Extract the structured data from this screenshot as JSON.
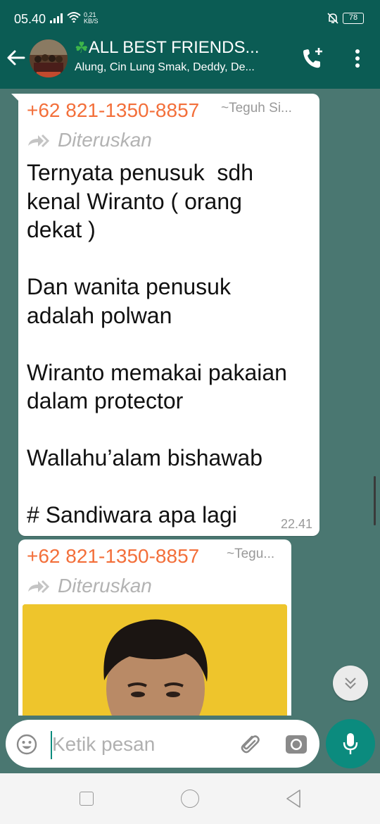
{
  "status": {
    "time": "05.40",
    "net_speed_value": "0,21",
    "net_speed_unit": "KB/S",
    "battery": "78"
  },
  "header": {
    "group_title": "ALL BEST FRIENDS...",
    "members": "Alung, Cin Lung Smak, Deddy, De...",
    "icons": [
      "back-arrow-icon",
      "add-call-icon",
      "more-vert-icon"
    ]
  },
  "messages": [
    {
      "sender": "+62 821-1350-8857",
      "push_name": "~Teguh Si...",
      "forwarded": "Diteruskan",
      "text": "Ternyata penusuk  sdh\nkenal Wiranto ( orang\ndekat )\n\nDan wanita penusuk\nadalah polwan\n\nWiranto memakai pakaian\ndalam protector\n\nWallahu’alam bishawab\n\n# Sandiwara apa lagi",
      "time": "22.41"
    },
    {
      "sender": "+62 821-1350-8857",
      "push_name": "~Tegu...",
      "forwarded": "Diteruskan"
    }
  ],
  "composer": {
    "placeholder": "Ketik pesan"
  },
  "colors": {
    "header": "#0b5c54",
    "chat_background": "#4a7771",
    "sender_name": "#f36f3a",
    "accent": "#0b8b7e"
  }
}
